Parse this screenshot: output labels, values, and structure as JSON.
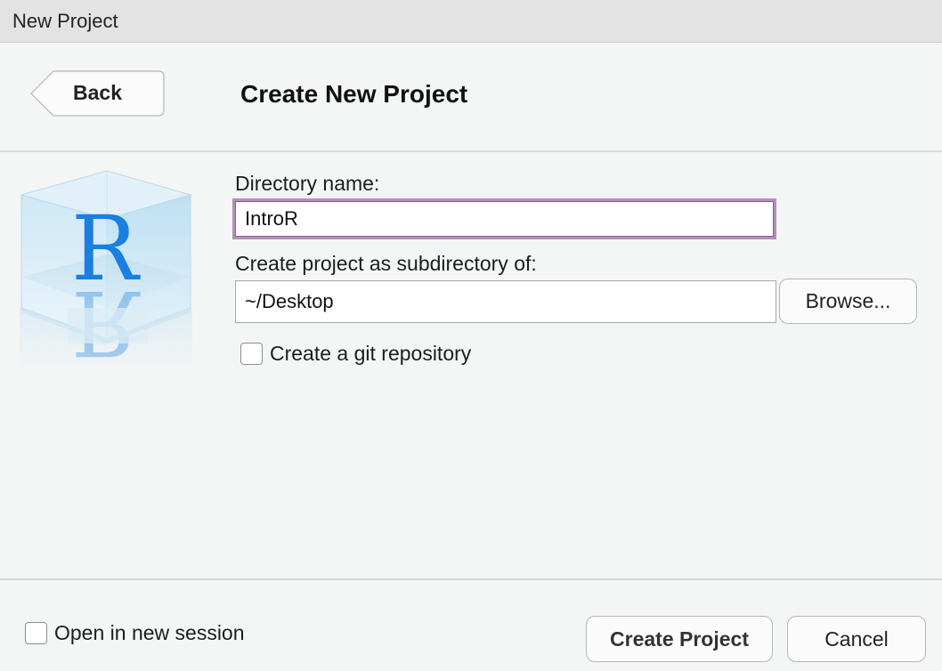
{
  "window": {
    "title": "New Project"
  },
  "header": {
    "back_label": "Back",
    "title": "Create New Project"
  },
  "form": {
    "directory_label": "Directory name:",
    "directory_value": "IntroR",
    "parent_label": "Create project as subdirectory of:",
    "parent_value": "~/Desktop",
    "browse_label": "Browse...",
    "git_label": "Create a git repository",
    "git_checked": false
  },
  "footer": {
    "new_session_label": "Open in new session",
    "new_session_checked": false,
    "create_label": "Create Project",
    "cancel_label": "Cancel"
  },
  "logo": {
    "letter": "R",
    "icon": "rstudio-cube-logo-icon"
  },
  "colors": {
    "focus_ring": "#b38fb8",
    "logo_blue": "#1a7fe0",
    "background": "#f4f5f5"
  }
}
